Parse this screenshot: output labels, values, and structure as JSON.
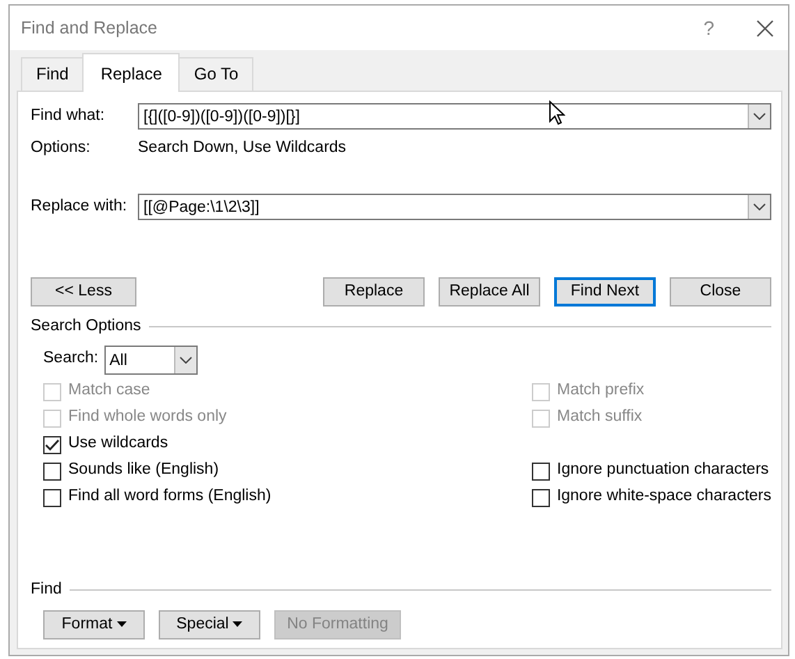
{
  "window": {
    "title": "Find and Replace",
    "help": "?"
  },
  "tabs": [
    {
      "label": "Find",
      "selected": false
    },
    {
      "label": "Replace",
      "selected": true
    },
    {
      "label": "Go To",
      "selected": false
    }
  ],
  "find_what": {
    "label": "Find what:",
    "value": "[{]([0-9])([0-9])([0-9])[}]"
  },
  "options": {
    "label": "Options:",
    "value": "Search Down, Use Wildcards"
  },
  "replace_with": {
    "label": "Replace with:",
    "value": "[[@Page:\\1\\2\\3]]"
  },
  "less_button": "<< Less",
  "buttons": [
    {
      "label": "Replace",
      "default": false
    },
    {
      "label": "Replace All",
      "default": false
    },
    {
      "label": "Find Next",
      "default": true
    },
    {
      "label": "Close",
      "default": false
    }
  ],
  "search_options": {
    "title": "Search Options",
    "search_label": "Search:",
    "search_value": "All",
    "rows": [
      {
        "left": {
          "label": "Match case",
          "checked": false,
          "disabled": true
        },
        "right": {
          "label": "Match prefix",
          "checked": false,
          "disabled": true
        }
      },
      {
        "left": {
          "label": "Find whole words only",
          "checked": false,
          "disabled": true
        },
        "right": {
          "label": "Match suffix",
          "checked": false,
          "disabled": true
        }
      },
      {
        "left": {
          "label": "Use wildcards",
          "checked": true,
          "disabled": false
        }
      },
      {
        "left": {
          "label": "Sounds like (English)",
          "checked": false,
          "disabled": false
        },
        "right": {
          "label": "Ignore punctuation characters",
          "checked": false,
          "disabled": false
        }
      },
      {
        "left": {
          "label": "Find all word forms (English)",
          "checked": false,
          "disabled": false
        },
        "right": {
          "label": "Ignore white-space characters",
          "checked": false,
          "disabled": false
        }
      }
    ]
  },
  "find_section": {
    "title": "Find",
    "buttons": [
      {
        "label": "Format",
        "dropdown": true,
        "disabled": false
      },
      {
        "label": "Special",
        "dropdown": true,
        "disabled": false
      },
      {
        "label": "No Formatting",
        "dropdown": false,
        "disabled": true
      }
    ]
  }
}
